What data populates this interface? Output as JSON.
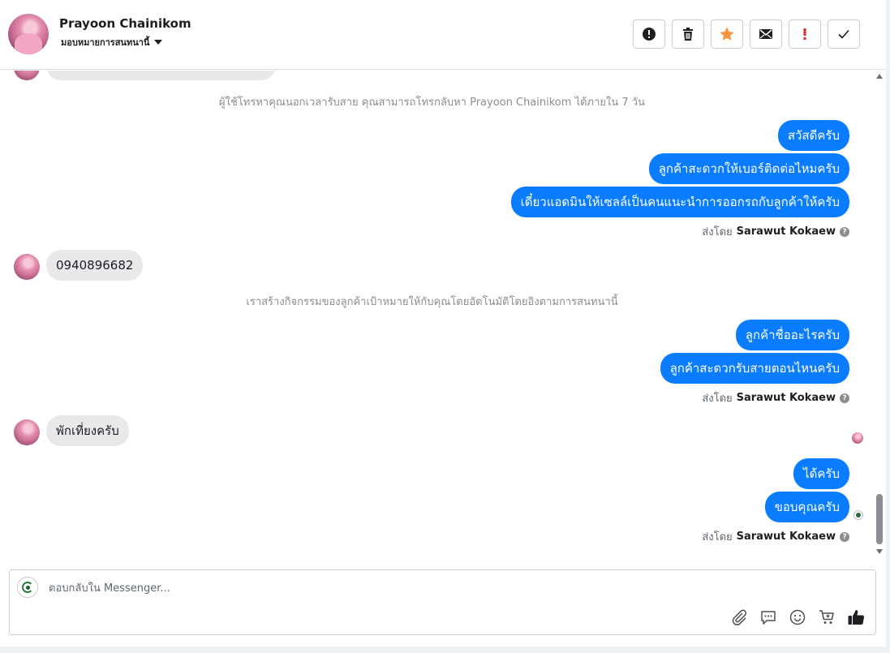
{
  "header": {
    "contact_name": "Prayoon Chainikom",
    "assign_label": "มอบหมายการสนทนานี้",
    "actions": [
      {
        "name": "spam-button",
        "icon": "alert-circle-icon"
      },
      {
        "name": "delete-button",
        "icon": "trash-icon"
      },
      {
        "name": "star-button",
        "icon": "star-icon",
        "color": "#f7923a"
      },
      {
        "name": "mark-unread-button",
        "icon": "envelope-icon"
      },
      {
        "name": "follow-up-button",
        "icon": "exclamation-icon",
        "color": "#e02424"
      },
      {
        "name": "done-button",
        "icon": "check-icon"
      }
    ]
  },
  "conversation": {
    "system_note_1": "ผู้ใช้โทรหาคุณนอกเวลารับสาย คุณสามารถโทรกลับหา Prayoon Chainikom ได้ภายใน 7 วัน",
    "out_group_1": [
      "สวัสดีครับ",
      "ลูกค้าสะดวกให้เบอร์ติดต่อไหมครับ",
      "เดี๋ยวแอดมินให้เซลล์เป็นคนแนะนำการออกรถกับลูกค้าให้ครับ"
    ],
    "sent_by_prefix": "ส่งโดย",
    "agent_name": "Sarawut Kokaew",
    "in_message_1": "0940896682",
    "system_note_2": "เราสร้างกิจกรรมของลูกค้าเป้าหมายให้กับคุณโดยอัตโนมัติโดยอิงตามการสนทนานี้",
    "out_group_2": [
      "ลูกค้าชื่ออะไรครับ",
      "ลูกค้าสะดวกรับสายตอนไหนครับ"
    ],
    "in_message_2": "พักเที่ยงครับ",
    "out_group_3": [
      "ได้ครับ",
      "ขอบคุณครับ"
    ]
  },
  "composer": {
    "placeholder": "ตอบกลับใน Messenger...",
    "tools": [
      "attachment-icon",
      "saved-reply-icon",
      "emoji-icon",
      "cart-icon",
      "thumbs-up-icon"
    ]
  }
}
